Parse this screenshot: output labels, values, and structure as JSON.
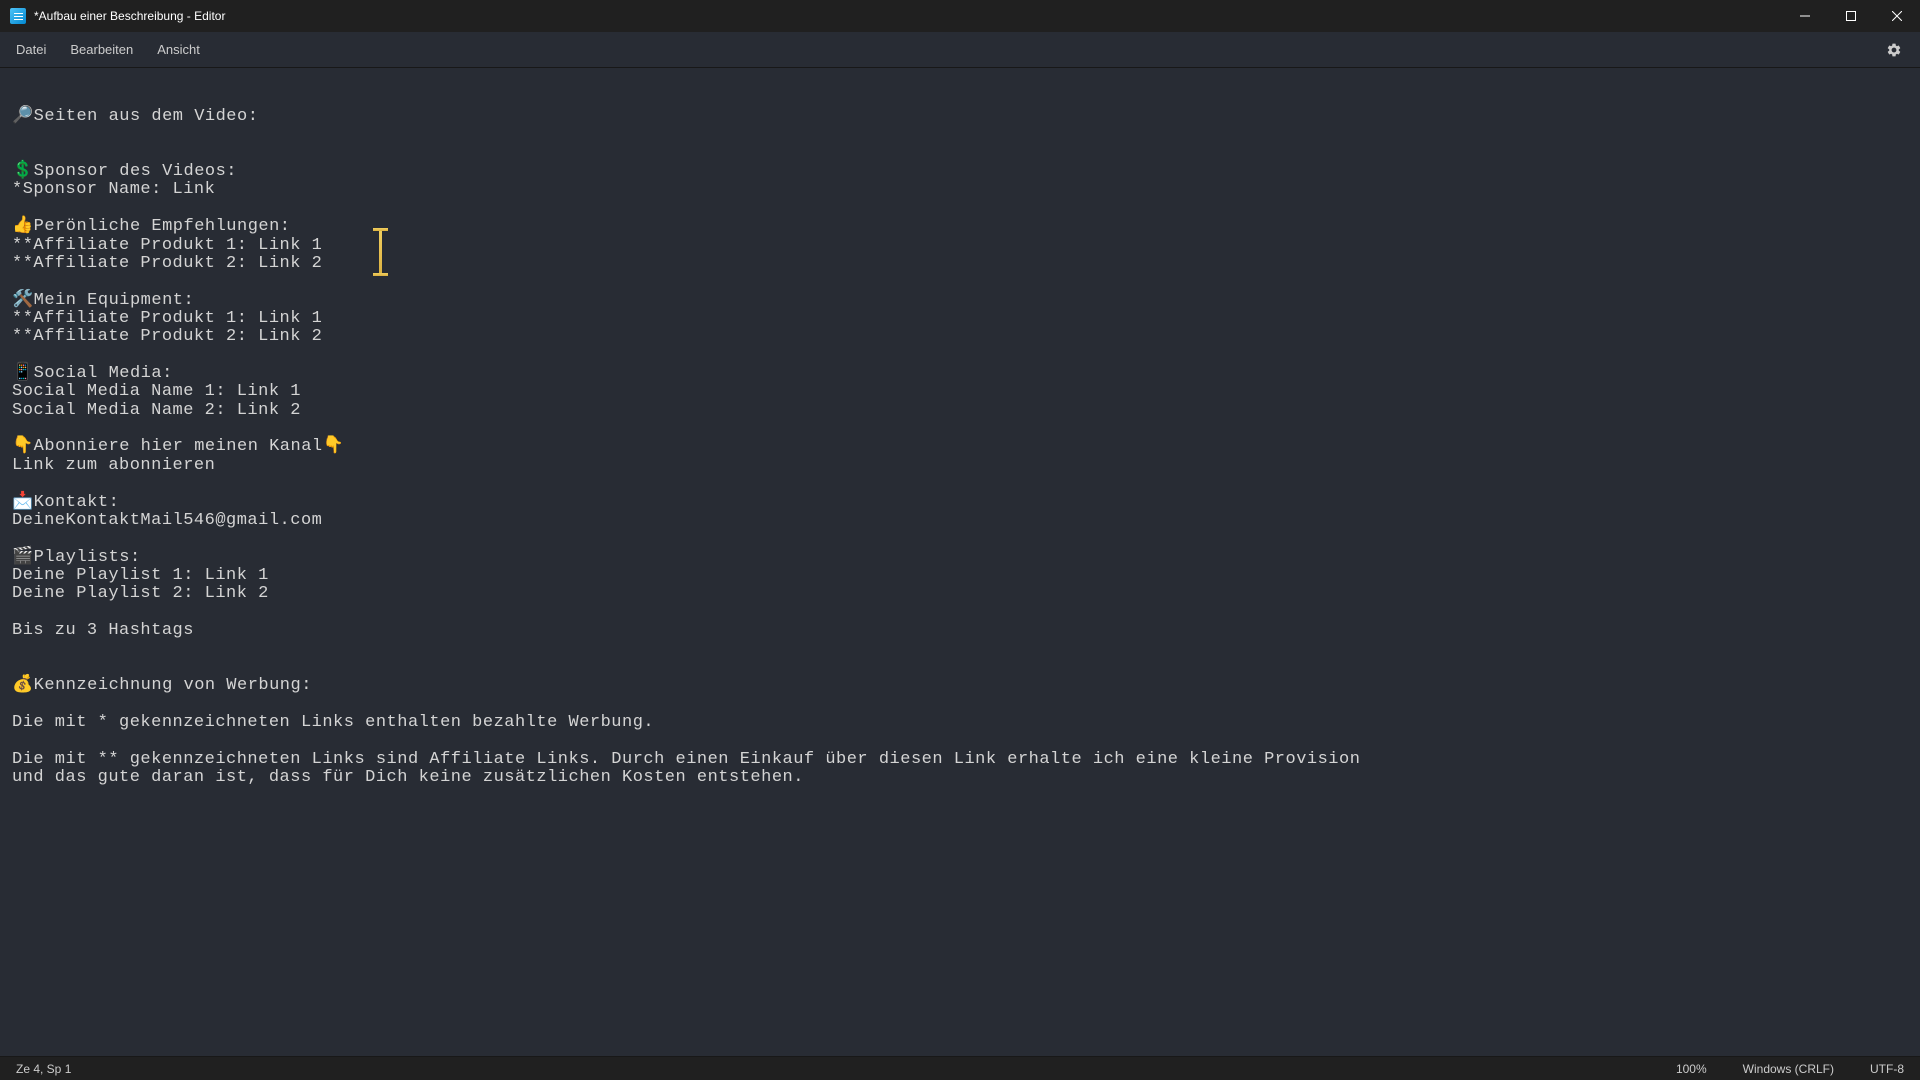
{
  "window": {
    "title": "*Aufbau einer Beschreibung - Editor"
  },
  "menu": {
    "file": "Datei",
    "edit": "Bearbeiten",
    "view": "Ansicht"
  },
  "content": {
    "text": "🔎Seiten aus dem Video:\n\n\n💲Sponsor des Videos:\n*Sponsor Name: Link\n\n👍Perönliche Empfehlungen:\n**Affiliate Produkt 1: Link 1\n**Affiliate Produkt 2: Link 2\n\n🛠️Mein Equipment:\n**Affiliate Produkt 1: Link 1\n**Affiliate Produkt 2: Link 2\n\n📱Social Media:\nSocial Media Name 1: Link 1\nSocial Media Name 2: Link 2\n\n👇Abonniere hier meinen Kanal👇\nLink zum abonnieren\n\n📩Kontakt:\nDeineKontaktMail546@gmail.com\n\n🎬Playlists:\nDeine Playlist 1: Link 1\nDeine Playlist 2: Link 2\n\nBis zu 3 Hashtags\n\n\n💰Kennzeichnung von Werbung:\n\nDie mit * gekennzeichneten Links enthalten bezahlte Werbung.\n\nDie mit ** gekennzeichneten Links sind Affiliate Links. Durch einen Einkauf über diesen Link erhalte ich eine kleine Provision und das gute daran ist, dass für Dich keine zusätzlichen Kosten entstehen."
  },
  "status": {
    "position": "Ze 4, Sp 1",
    "zoom": "100%",
    "line_ending": "Windows (CRLF)",
    "encoding": "UTF-8"
  }
}
